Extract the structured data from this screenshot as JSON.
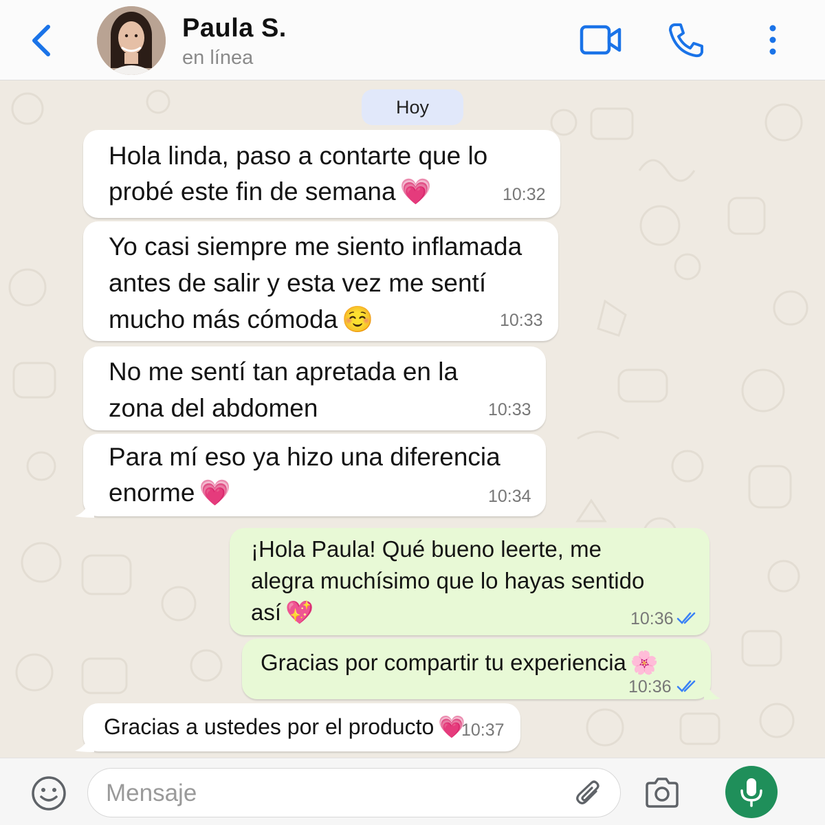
{
  "header": {
    "contact_name": "Paula S.",
    "status": "en línea"
  },
  "chat": {
    "day_label": "Hoy",
    "messages": [
      {
        "direction": "in",
        "text": "Hola linda, paso a contarte que lo\nprobé este fin de semana",
        "emoji": "💗",
        "time": "10:32"
      },
      {
        "direction": "in",
        "text": "Yo casi siempre me siento inflamada\nantes de salir y esta vez me sentí\nmucho más cómoda",
        "emoji": "☺️",
        "time": "10:33"
      },
      {
        "direction": "in",
        "text": "No me sentí tan apretada en la\nzona del abdomen",
        "emoji": "",
        "time": "10:33"
      },
      {
        "direction": "in",
        "text": "Para mí eso ya hizo una diferencia\nenorme",
        "emoji": "💗",
        "time": "10:34"
      },
      {
        "direction": "out",
        "text": "¡Hola Paula! Qué bueno leerte, me\nalegra muchísimo que lo hayas sentido\nasí",
        "emoji": "💖",
        "time": "10:36",
        "status": "read"
      },
      {
        "direction": "out",
        "text": "Gracias por compartir tu experiencia",
        "emoji": "🌸",
        "time": "10:36",
        "status": "read"
      },
      {
        "direction": "in",
        "text": "Gracias a ustedes por el producto",
        "emoji": "💗",
        "time": "10:37"
      }
    ]
  },
  "composer": {
    "placeholder": "Mensaje"
  },
  "colors": {
    "accent": "#1a73e8",
    "incoming": "#ffffff",
    "outgoing": "#e8f9d6",
    "mic": "#1f8f5a",
    "read_tick": "#3b82f6"
  },
  "icons": [
    "back-arrow-icon",
    "video-call-icon",
    "phone-icon",
    "more-vert-icon",
    "emoji-icon",
    "attach-icon",
    "camera-icon",
    "mic-icon",
    "read-receipt-icon"
  ]
}
